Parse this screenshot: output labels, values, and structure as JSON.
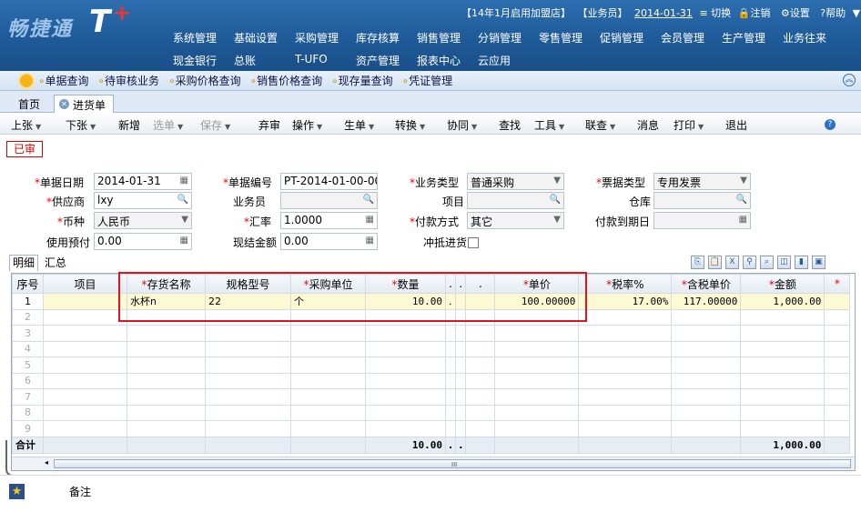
{
  "header": {
    "logo_text": "畅捷通",
    "logo_t": "T",
    "logo_plus": "+",
    "status_items": [
      "【14年1月启用加盟店】",
      "【业务员】",
      "2014-01-31",
      "≡ 切换",
      "注销",
      "设置",
      "帮助"
    ],
    "menu_row1": [
      "系统管理",
      "基础设置",
      "采购管理",
      "库存核算",
      "销售管理",
      "分销管理",
      "零售管理",
      "促销管理",
      "会员管理",
      "生产管理",
      "业务往来"
    ],
    "menu_row2": [
      "现金银行",
      "总账",
      "T-UFO",
      "资产管理",
      "报表中心",
      "云应用"
    ]
  },
  "quicklinks": [
    "单据查询",
    "待审核业务",
    "采购价格查询",
    "销售价格查询",
    "现存量查询",
    "凭证管理"
  ],
  "tabs": {
    "home": "首页",
    "active": "进货单"
  },
  "toolbar": {
    "items": [
      {
        "label": "上张",
        "arrow": "▼"
      },
      {
        "label": "下张",
        "arrow": "▼"
      },
      {
        "label": "新增",
        "arrow": ""
      },
      {
        "label": "选单",
        "arrow": "▼",
        "disabled": true
      },
      {
        "label": "保存",
        "arrow": "▼",
        "disabled": true
      },
      {
        "label": "弃审",
        "arrow": ""
      },
      {
        "label": "操作",
        "arrow": "▼"
      },
      {
        "label": "生单",
        "arrow": "▼"
      },
      {
        "label": "转换",
        "arrow": "▼"
      },
      {
        "label": "协同",
        "arrow": "▼"
      },
      {
        "label": "查找",
        "arrow": ""
      },
      {
        "label": "工具",
        "arrow": "▼"
      },
      {
        "label": "联查",
        "arrow": "▼"
      },
      {
        "label": "消息",
        "arrow": ""
      },
      {
        "label": "打印",
        "arrow": "▼"
      },
      {
        "label": "退出",
        "arrow": ""
      }
    ]
  },
  "stamp": "已审",
  "form": {
    "date_label": "单据日期",
    "date_value": "2014-01-31",
    "code_label": "单据编号",
    "code_value": "PT-2014-01-00-00...",
    "biztype_label": "业务类型",
    "biztype_value": "普通采购",
    "invtype_label": "票据类型",
    "invtype_value": "专用发票",
    "supplier_label": "供应商",
    "supplier_value": "lxy",
    "clerk_label": "业务员",
    "clerk_value": "",
    "project_label": "项目",
    "project_value": "",
    "warehouse_label": "仓库",
    "warehouse_value": "",
    "currency_label": "币种",
    "currency_value": "人民币",
    "rate_label": "汇率",
    "rate_value": "1.0000",
    "payway_label": "付款方式",
    "payway_value": "其它",
    "paydue_label": "付款到期日",
    "paydue_value": "",
    "prepay_label": "使用预付",
    "prepay_value": "0.00",
    "settle_label": "现结金额",
    "settle_value": "0.00",
    "offset_label": "冲抵进货"
  },
  "subtabs": [
    "明细",
    "汇总"
  ],
  "grid": {
    "headers": [
      {
        "text": "序号",
        "req": false
      },
      {
        "text": "项目",
        "req": false
      },
      {
        "text": "存货名称",
        "req": true
      },
      {
        "text": "规格型号",
        "req": false
      },
      {
        "text": "采购单位",
        "req": true
      },
      {
        "text": "数量",
        "req": true
      },
      {
        "text": ".",
        "req": false
      },
      {
        "text": ".",
        "req": false
      },
      {
        "text": ".",
        "req": false
      },
      {
        "text": "单价",
        "req": true
      },
      {
        "text": "税率%",
        "req": true
      },
      {
        "text": "含税单价",
        "req": true
      },
      {
        "text": "金额",
        "req": true
      },
      {
        "text": "",
        "req": true
      }
    ],
    "row1": [
      "1",
      "",
      "水杯n",
      "22",
      "个",
      "10.00",
      ".",
      "",
      "",
      "100.00000",
      "17.00%",
      "117.00000",
      "1,000.00",
      ""
    ],
    "empty_rows": [
      "2",
      "3",
      "4",
      "5",
      "6",
      "7",
      "8",
      "9"
    ],
    "total_label": "合计",
    "total_qty": "10.00",
    "total_dot1": ".",
    "total_dot2": ".",
    "total_amount": "1,000.00"
  },
  "footer": {
    "note_label": "备注"
  }
}
